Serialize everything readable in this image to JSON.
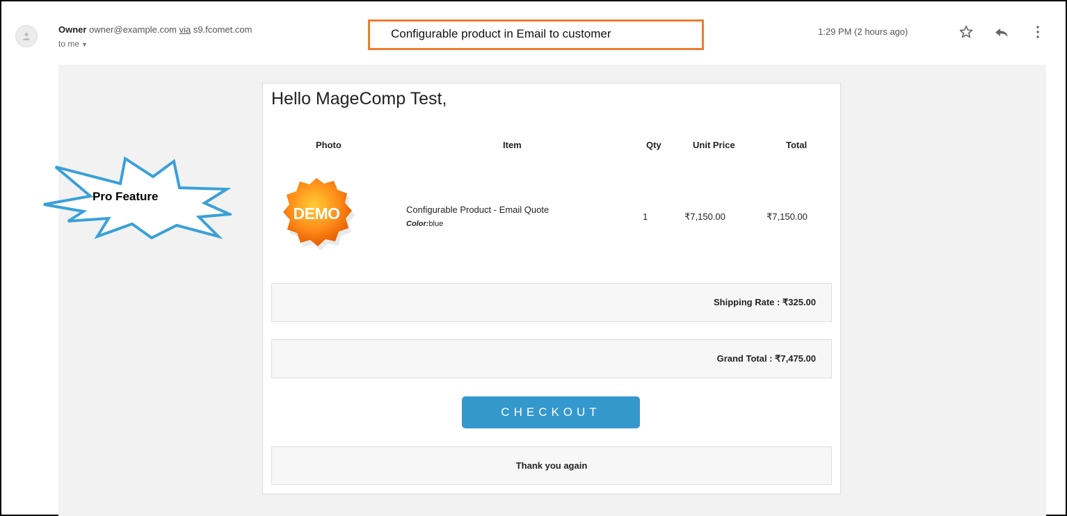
{
  "header": {
    "sender_name": "Owner",
    "sender_email": "owner@example.com",
    "via_label": "via",
    "via_domain": "s9.fcomet.com",
    "to_label": "to me",
    "timestamp": "1:29 PM (2 hours ago)",
    "icons": [
      "avatar-icon",
      "star-icon",
      "reply-icon",
      "more-vert-icon",
      "dropdown-caret-icon"
    ]
  },
  "annotation": {
    "callout": "Configurable product in Email to customer",
    "burst_label": "Pro Feature",
    "callout_color": "#ed7d31",
    "burst_color": "#3aa0d8"
  },
  "email": {
    "greeting": "Hello MageComp Test,",
    "columns": [
      "Photo",
      "Item",
      "Qty",
      "Unit Price",
      "Total"
    ],
    "item": {
      "image_label": "DEMO",
      "name": "Configurable Product - Email Quote",
      "option_label": "Color:",
      "option_value": "blue",
      "qty": "1",
      "unit_price": "₹7,150.00",
      "total": "₹7,150.00"
    },
    "shipping": "Shipping Rate : ₹325.00",
    "grand_total": "Grand Total : ₹7,475.00",
    "checkout_label": "CHECKOUT",
    "thanks": "Thank you again",
    "button_color": "#3598cc"
  }
}
